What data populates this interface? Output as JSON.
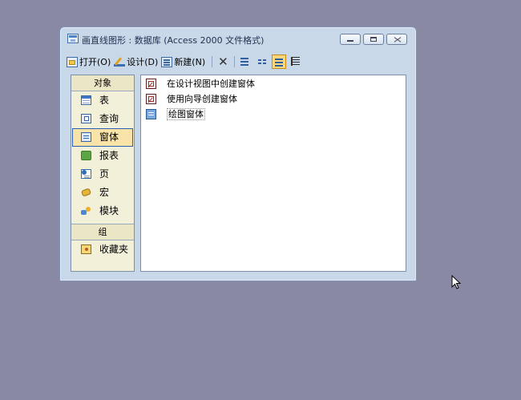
{
  "window": {
    "title": "画直线图形 : 数据库 (Access 2000 文件格式)"
  },
  "toolbar": {
    "open_label": "打开(O)",
    "design_label": "设计(D)",
    "new_label": "新建(N)",
    "delete_label": "✕"
  },
  "objects_pane": {
    "header": "对象",
    "items": [
      {
        "label": "表",
        "icon": "table-icon"
      },
      {
        "label": "查询",
        "icon": "query-icon"
      },
      {
        "label": "窗体",
        "icon": "form-icon",
        "selected": true
      },
      {
        "label": "报表",
        "icon": "report-icon"
      },
      {
        "label": "页",
        "icon": "page-icon"
      },
      {
        "label": "宏",
        "icon": "macro-icon"
      },
      {
        "label": "模块",
        "icon": "module-icon"
      }
    ],
    "groups_header": "组",
    "groups": [
      {
        "label": "收藏夹",
        "icon": "favorites-folder-icon"
      }
    ]
  },
  "list": {
    "items": [
      {
        "label": "在设计视图中创建窗体",
        "icon": "design-wizard-icon"
      },
      {
        "label": "使用向导创建窗体",
        "icon": "form-wizard-icon"
      },
      {
        "label": "绘图窗体",
        "icon": "form-icon"
      }
    ]
  },
  "colors": {
    "desktop": "#8a89a4",
    "selected_item_bg": "#f9e3a9",
    "selected_item_border": "#2a5fb3"
  }
}
